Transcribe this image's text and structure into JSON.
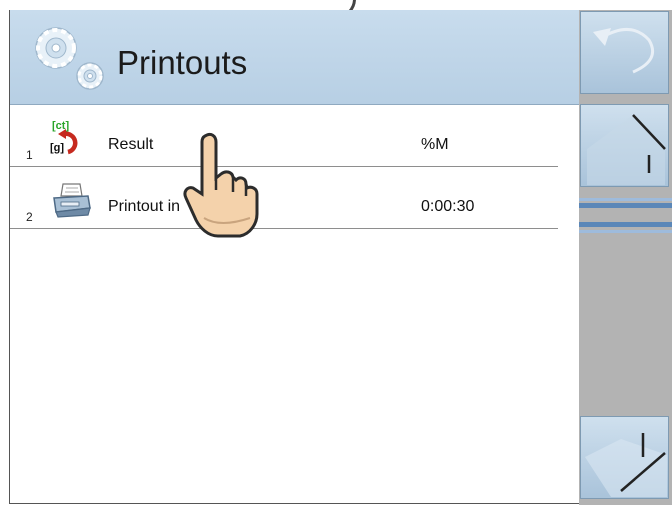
{
  "header": {
    "title": "Printouts",
    "icon": "settings-gears-icon"
  },
  "rows": [
    {
      "num": "1",
      "icon": "result-printout-icon",
      "icon_text_top": "[ct]",
      "icon_text_bottom": "[g]",
      "label": "Result",
      "value": "%M"
    },
    {
      "num": "2",
      "icon": "printer-icon",
      "label": "Printout in",
      "value": "0:00:30"
    }
  ],
  "sidebar": {
    "buttons": [
      "back-icon",
      "home-icon",
      "exit-icon"
    ]
  },
  "colors": {
    "header_bg": "#bcd3e7",
    "sidebar_bg": "#b3b3b3",
    "scroll_accent": "#5b87b8",
    "icon_green": "#2aa52a",
    "icon_red": "#c62a1f"
  }
}
